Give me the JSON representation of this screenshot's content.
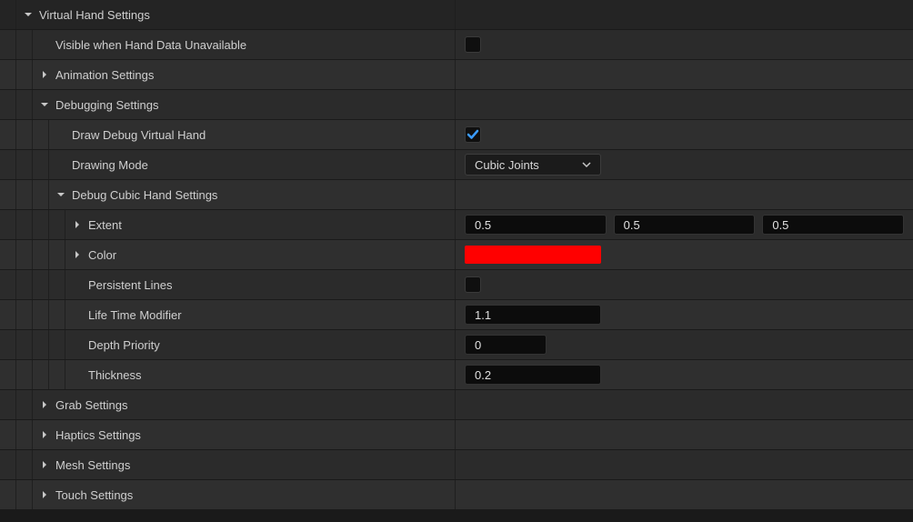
{
  "sections": {
    "virtual_hand": {
      "label": "Virtual Hand Settings"
    },
    "visible_unavailable": {
      "label": "Visible when Hand Data Unavailable",
      "checked": false
    },
    "animation": {
      "label": "Animation Settings"
    },
    "debugging": {
      "label": "Debugging Settings"
    },
    "draw_debug": {
      "label": "Draw Debug Virtual Hand",
      "checked": true
    },
    "drawing_mode": {
      "label": "Drawing Mode",
      "value": "Cubic Joints"
    },
    "debug_cubic": {
      "label": "Debug Cubic Hand Settings"
    },
    "extent": {
      "label": "Extent",
      "x": "0.5",
      "y": "0.5",
      "z": "0.5"
    },
    "color": {
      "label": "Color",
      "hex": "#ff0000"
    },
    "persistent": {
      "label": "Persistent Lines",
      "checked": false
    },
    "lifetime": {
      "label": "Life Time Modifier",
      "value": "1.1"
    },
    "depth": {
      "label": "Depth Priority",
      "value": "0"
    },
    "thickness": {
      "label": "Thickness",
      "value": "0.2"
    },
    "grab": {
      "label": "Grab Settings"
    },
    "haptics": {
      "label": "Haptics Settings"
    },
    "mesh": {
      "label": "Mesh Settings"
    },
    "touch": {
      "label": "Touch Settings"
    }
  }
}
